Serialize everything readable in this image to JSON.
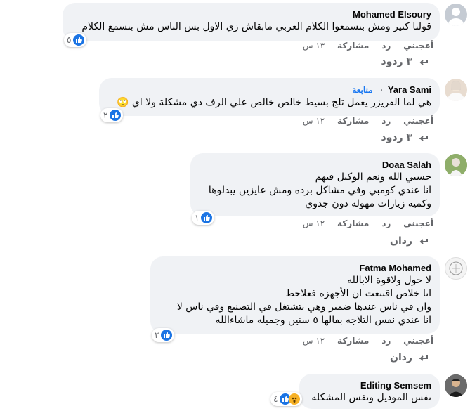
{
  "comments": [
    {
      "author": "Mohamed Elsoury",
      "follow": "",
      "lines": [
        "قولنا كتير ومش بتسمعوا الكلام العربي مابقاش زي الاول بس الناس مش بتسمع الكلام"
      ],
      "reaction_count": "٥",
      "like": "أعجبني",
      "reply": "رد",
      "share": "مشاركة",
      "time": "١٣ س",
      "replies": "٣ ردود"
    },
    {
      "author": "Yara Sami",
      "follow": "متابعة",
      "lines": [
        "هي لما الفريزر يعمل تلج بسيط خالص خالص علي الرف دي مشكلة ولا اي 🙄"
      ],
      "reaction_count": "٢",
      "like": "أعجبني",
      "reply": "رد",
      "share": "مشاركة",
      "time": "١٢ س",
      "replies": "٣ ردود"
    },
    {
      "author": "Doaa Salah",
      "follow": "",
      "lines": [
        "حسبي الله ونعم الوكيل فيهم",
        "انا عندي كومبي وفي مشاكل برده ومش عايزين يبدلوها",
        "وكمية زيارات مهوله دون جدوي"
      ],
      "reaction_count": "١",
      "like": "أعجبني",
      "reply": "رد",
      "share": "مشاركة",
      "time": "١٢ س",
      "replies": "ردان"
    },
    {
      "author": "Fatma Mohamed",
      "follow": "",
      "lines": [
        "لا حول ولاقوة الابالله",
        "انا خلاص اقتنعت ان الأجهزه فعلاحظ",
        "وان في ناس عندها ضمير وهي بتشتغل في التصنيع وفي ناس لا",
        "انا عندي نفس التلاجه بقالها ٥ سنين وجميله ماشاءالله"
      ],
      "reaction_count": "٢",
      "like": "أعجبني",
      "reply": "رد",
      "share": "مشاركة",
      "time": "١٢ س",
      "replies": "ردان"
    },
    {
      "author": "Editing Semsem",
      "follow": "",
      "lines": [
        "نفس الموديل ونفس المشكله"
      ],
      "reaction_count": "٤",
      "like": "",
      "reply": "",
      "share": "",
      "time": "",
      "replies": ""
    }
  ],
  "colors": {
    "bubble": "#f0f2f5",
    "like_blue": "#1b74e4",
    "follow_blue": "#1877f2",
    "meta_gray": "#65676b"
  }
}
